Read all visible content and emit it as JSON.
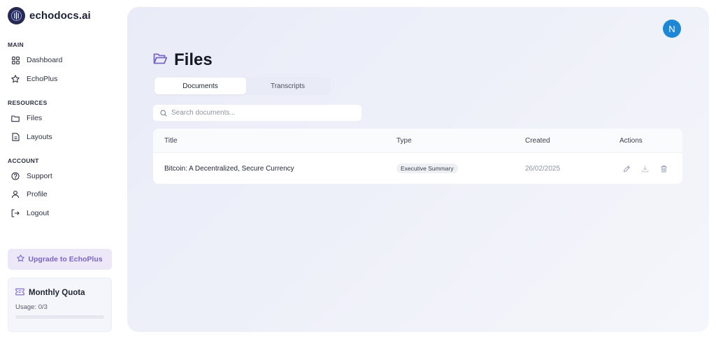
{
  "app": {
    "name": "echodocs.ai"
  },
  "sidebar": {
    "sections": [
      {
        "title": "MAIN",
        "items": [
          {
            "label": "Dashboard",
            "icon": "dashboard-icon"
          },
          {
            "label": "EchoPlus",
            "icon": "star-icon"
          }
        ]
      },
      {
        "title": "RESOURCES",
        "items": [
          {
            "label": "Files",
            "icon": "folder-icon"
          },
          {
            "label": "Layouts",
            "icon": "layout-file-icon"
          }
        ]
      },
      {
        "title": "ACCOUNT",
        "items": [
          {
            "label": "Support",
            "icon": "help-circle-icon"
          },
          {
            "label": "Profile",
            "icon": "user-icon"
          },
          {
            "label": "Logout",
            "icon": "logout-icon"
          }
        ]
      }
    ],
    "upgrade_label": "Upgrade to EchoPlus",
    "quota": {
      "title": "Monthly Quota",
      "usage": "Usage: 0/3",
      "fraction": 0
    }
  },
  "header": {
    "avatar_initial": "N"
  },
  "page": {
    "title": "Files"
  },
  "tabs": [
    {
      "label": "Documents",
      "active": true
    },
    {
      "label": "Transcripts",
      "active": false
    }
  ],
  "search": {
    "placeholder": "Search documents...",
    "value": ""
  },
  "table": {
    "columns": [
      "Title",
      "Type",
      "Created",
      "Actions"
    ],
    "rows": [
      {
        "title": "Bitcoin: A Decentralized, Secure Currency",
        "type": "Executive Summary",
        "created": "26/02/2025"
      }
    ]
  },
  "colors": {
    "accent": "#7a64c4",
    "avatar": "#1e88d6",
    "brand": "#27294d"
  }
}
